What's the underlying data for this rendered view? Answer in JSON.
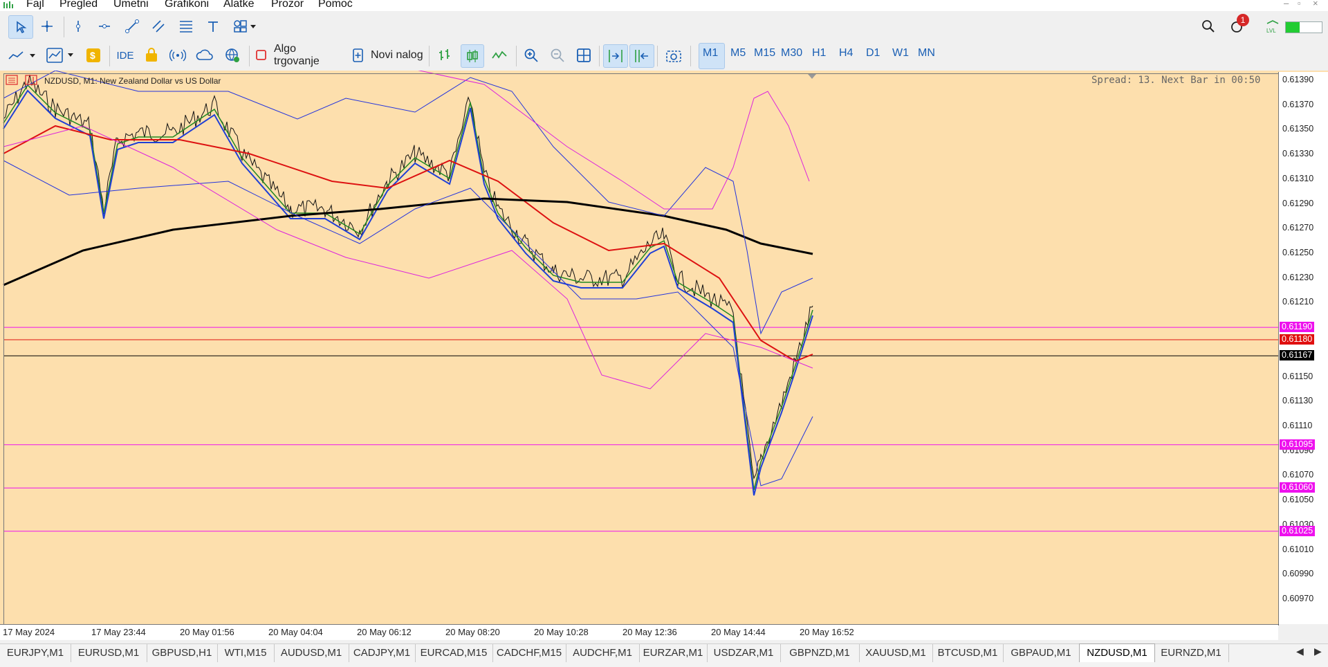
{
  "menu": [
    "Fajl",
    "Pregled",
    "Umetni",
    "Grafikoni",
    "Alatke",
    "Prozor",
    "Pomoć"
  ],
  "toolbar2": {
    "ide_label": "IDE",
    "algo_label": "Algo trgovanje",
    "order_label": "Novi nalog"
  },
  "timeframes": [
    "M1",
    "M5",
    "M15",
    "M30",
    "H1",
    "H4",
    "D1",
    "W1",
    "MN"
  ],
  "active_timeframe": "M1",
  "notification_count": "1",
  "chart": {
    "title": "NZDUSD, M1:  New Zealand Dollar vs US Dollar",
    "spread": "Spread: 13. Next Bar in 00:50",
    "price_ticks": [
      "0.61390",
      "0.61370",
      "0.61350",
      "0.61330",
      "0.61310",
      "0.61290",
      "0.61270",
      "0.61250",
      "0.61230",
      "0.61210",
      "0.61150",
      "0.61130",
      "0.61110",
      "0.61090",
      "0.61070",
      "0.61050",
      "0.61030",
      "0.61010",
      "0.60990",
      "0.60970"
    ],
    "price_labels": [
      {
        "text": "0.61190",
        "color": "#ee11ee"
      },
      {
        "text": "0.61180",
        "color": "#e01010"
      },
      {
        "text": "0.61167",
        "color": "#000000"
      },
      {
        "text": "0.61095",
        "color": "#ee11ee"
      },
      {
        "text": "0.61060",
        "color": "#ee11ee"
      },
      {
        "text": "0.61025",
        "color": "#ee11ee"
      }
    ],
    "time_ticks": [
      "17 May 2024",
      "17 May 23:44",
      "20 May 01:56",
      "20 May 04:04",
      "20 May 06:12",
      "20 May 08:20",
      "20 May 10:28",
      "20 May 12:36",
      "20 May 14:44",
      "20 May 16:52"
    ],
    "background": "#fddfad"
  },
  "tabs": [
    "EURJPY,M1",
    "EURUSD,M1",
    "GBPUSD,H1",
    "WTI,M15",
    "AUDUSD,M1",
    "CADJPY,M1",
    "EURCAD,M15",
    "CADCHF,M15",
    "AUDCHF,M1",
    "EURZAR,M1",
    "USDZAR,M1",
    "GBPNZD,M1",
    "XAUUSD,M1",
    "BTCUSD,M1",
    "GBPAUD,M1",
    "NZDUSD,M1",
    "EURNZD,M1"
  ],
  "active_tab": "NZDUSD,M1"
}
